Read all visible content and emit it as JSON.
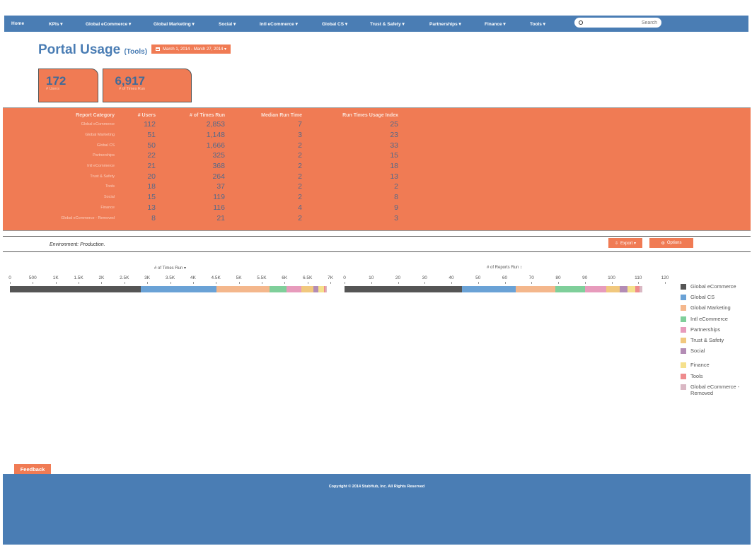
{
  "nav": {
    "items": [
      "Home",
      "KPIs ▾",
      "Global eCommerce ▾",
      "Global Marketing ▾",
      "Social ▾",
      "Intl eCommerce ▾",
      "Global CS ▾",
      "Trust & Safety ▾",
      "Partnerships ▾",
      "Finance ▾",
      "Tools ▾"
    ],
    "search_placeholder": "Search"
  },
  "header": {
    "title": "Portal Usage",
    "subtitle": "(Tools)",
    "date_range": "March 1, 2014 - March 27, 2014 ▾"
  },
  "kpis": [
    {
      "value": "172",
      "label": "# Users"
    },
    {
      "value": "6,917",
      "label": "# of Times Run"
    }
  ],
  "table": {
    "headers": [
      "Report Category",
      "# Users",
      "# of Times Run",
      "Median Run Time",
      "Run Times Usage Index"
    ],
    "rows": [
      [
        "Global eCommerce",
        "112",
        "2,853",
        "7",
        "25"
      ],
      [
        "Global Marketing",
        "51",
        "1,148",
        "3",
        "23"
      ],
      [
        "Global CS",
        "50",
        "1,666",
        "2",
        "33"
      ],
      [
        "Partnerships",
        "22",
        "325",
        "2",
        "15"
      ],
      [
        "Intl eCommerce",
        "21",
        "368",
        "2",
        "18"
      ],
      [
        "Trust & Safety",
        "20",
        "264",
        "2",
        "13"
      ],
      [
        "Tools",
        "18",
        "37",
        "2",
        "2"
      ],
      [
        "Social",
        "15",
        "119",
        "2",
        "8"
      ],
      [
        "Finance",
        "13",
        "116",
        "4",
        "9"
      ],
      [
        "Global eCommerce - Removed",
        "8",
        "21",
        "2",
        "3"
      ]
    ]
  },
  "environment": "Environment: Production.",
  "buttons": {
    "export": "Export ▾",
    "options": "Options"
  },
  "colors": {
    "Global eCommerce": "#555555",
    "Global CS": "#6aa2d6",
    "Global Marketing": "#f4b78c",
    "Intl eCommerce": "#7fcf9a",
    "Partnerships": "#e79bbc",
    "Trust & Safety": "#f1c87e",
    "Social": "#b38cb5",
    "Finance": "#f5e08c",
    "Tools": "#ee8b8d",
    "Global eCommerce - Removed": "#dab8c4"
  },
  "chart_data": [
    {
      "type": "bar",
      "orientation": "horizontal-stacked",
      "title": "# of Times Run ▾",
      "xlim": [
        0,
        7000
      ],
      "ticks": [
        "0",
        "500",
        "1K",
        "1.5K",
        "2K",
        "2.5K",
        "3K",
        "3.5K",
        "4K",
        "4.5K",
        "5K",
        "5.5K",
        "6K",
        "6.5K",
        "7K"
      ],
      "series": [
        {
          "name": "Global eCommerce",
          "values": [
            2853
          ]
        },
        {
          "name": "Global CS",
          "values": [
            1666
          ]
        },
        {
          "name": "Global Marketing",
          "values": [
            1148
          ]
        },
        {
          "name": "Intl eCommerce",
          "values": [
            368
          ]
        },
        {
          "name": "Partnerships",
          "values": [
            325
          ]
        },
        {
          "name": "Trust & Safety",
          "values": [
            264
          ]
        },
        {
          "name": "Social",
          "values": [
            119
          ]
        },
        {
          "name": "Finance",
          "values": [
            116
          ]
        },
        {
          "name": "Tools",
          "values": [
            37
          ]
        },
        {
          "name": "Global eCommerce - Removed",
          "values": [
            21
          ]
        }
      ]
    },
    {
      "type": "bar",
      "orientation": "horizontal-stacked",
      "title": "# of Reports Run ↕",
      "xlim": [
        0,
        120
      ],
      "ticks": [
        "0",
        "10",
        "20",
        "30",
        "40",
        "50",
        "60",
        "70",
        "80",
        "90",
        "100",
        "110",
        "120"
      ],
      "series": [
        {
          "name": "Global eCommerce",
          "values": [
            44
          ]
        },
        {
          "name": "Global CS",
          "values": [
            20
          ]
        },
        {
          "name": "Global Marketing",
          "values": [
            15
          ]
        },
        {
          "name": "Intl eCommerce",
          "values": [
            11
          ]
        },
        {
          "name": "Partnerships",
          "values": [
            8
          ]
        },
        {
          "name": "Trust & Safety",
          "values": [
            5
          ]
        },
        {
          "name": "Social",
          "values": [
            3
          ]
        },
        {
          "name": "Finance",
          "values": [
            3
          ]
        },
        {
          "name": "Tools",
          "values": [
            1.5
          ]
        },
        {
          "name": "Global eCommerce - Removed",
          "values": [
            1
          ]
        }
      ]
    }
  ],
  "legend": [
    "Global eCommerce",
    "Global CS",
    "Global Marketing",
    "Intl eCommerce",
    "Partnerships",
    "Trust & Safety",
    "Social",
    "Finance",
    "Tools",
    "Global eCommerce - Removed"
  ],
  "feedback": "Feedback",
  "footer": "Copyright © 2014 StubHub, Inc. All Rights Reserved"
}
